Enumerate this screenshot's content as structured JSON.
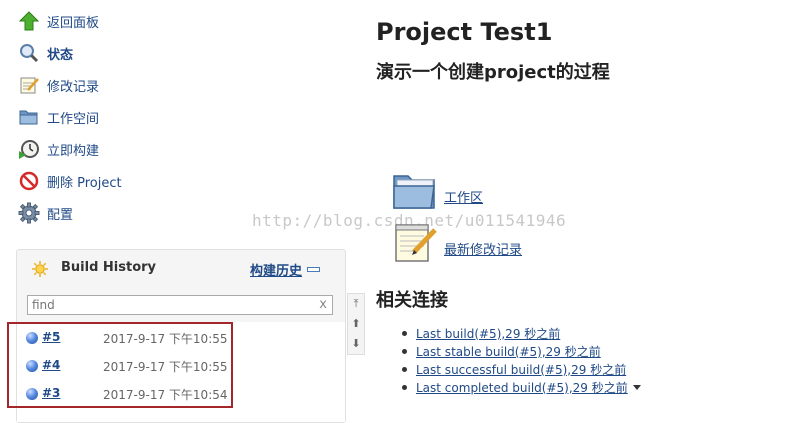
{
  "sidebar": {
    "items": [
      {
        "label": "返回面板",
        "icon": "up-arrow-icon"
      },
      {
        "label": "状态",
        "icon": "search-icon"
      },
      {
        "label": "修改记录",
        "icon": "notepad-icon"
      },
      {
        "label": "工作空间",
        "icon": "folder-icon"
      },
      {
        "label": "立即构建",
        "icon": "build-clock-icon"
      },
      {
        "label": "删除 Project",
        "icon": "no-entry-icon"
      },
      {
        "label": "配置",
        "icon": "gear-icon"
      }
    ]
  },
  "build_history": {
    "title": "Build History",
    "trend_label": "构建历史",
    "search_placeholder": "find",
    "clear_label": "x",
    "builds": [
      {
        "number": "#5",
        "time": "2017-9-17 下午10:55"
      },
      {
        "number": "#4",
        "time": "2017-9-17 下午10:55"
      },
      {
        "number": "#3",
        "time": "2017-9-17 下午10:54"
      }
    ]
  },
  "main": {
    "title": "Project Test1",
    "description": "演示一个创建project的过程",
    "workspace_label": "工作区",
    "changes_label": "最新修改记录",
    "related_heading": "相关连接",
    "related_links": [
      "Last build(#5),29 秒之前",
      "Last stable build(#5),29 秒之前",
      "Last successful build(#5),29 秒之前",
      "Last completed build(#5),29 秒之前"
    ]
  },
  "watermark": "http://blog.csdn.net/u011541946",
  "colors": {
    "link": "#204a87",
    "highlight_box": "#a3262b",
    "success_ball": "#4a7ad8"
  }
}
